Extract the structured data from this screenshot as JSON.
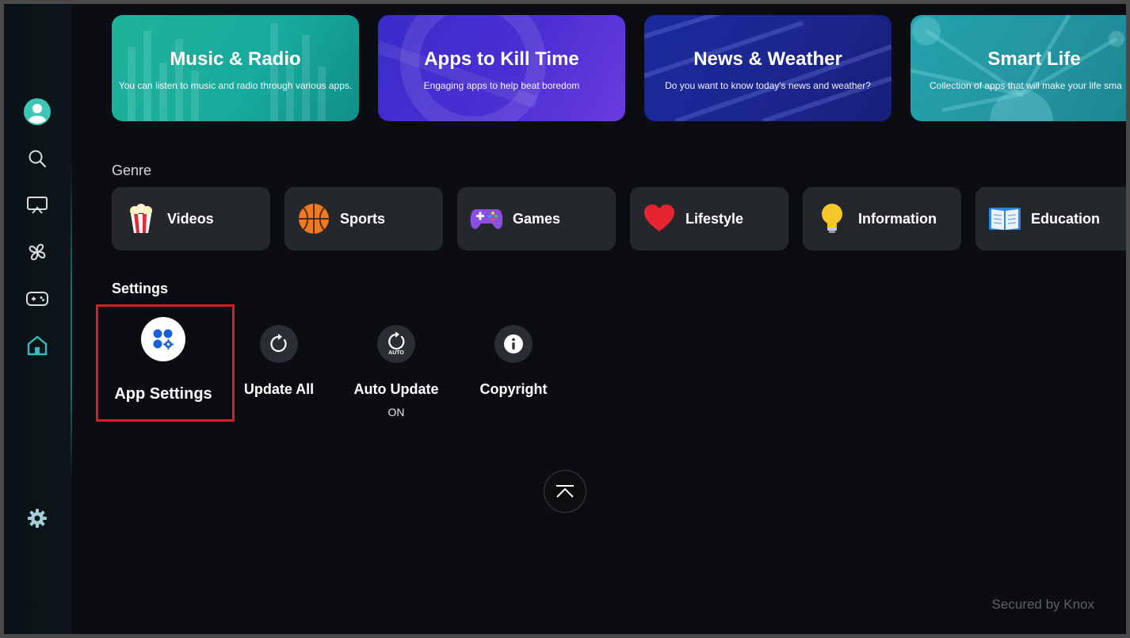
{
  "banners": [
    {
      "title": "Music & Radio",
      "subtitle": "You can listen to music and radio through various apps."
    },
    {
      "title": "Apps to Kill Time",
      "subtitle": "Engaging apps to help beat boredom"
    },
    {
      "title": "News & Weather",
      "subtitle": "Do you want to know today's news and weather?"
    },
    {
      "title": "Smart Life",
      "subtitle": "Collection of apps that will make your life sma"
    }
  ],
  "genre": {
    "title": "Genre",
    "items": [
      {
        "label": "Videos",
        "icon": "popcorn-icon"
      },
      {
        "label": "Sports",
        "icon": "basketball-icon"
      },
      {
        "label": "Games",
        "icon": "gamepad-icon"
      },
      {
        "label": "Lifestyle",
        "icon": "heart-icon"
      },
      {
        "label": "Information",
        "icon": "lightbulb-icon"
      },
      {
        "label": "Education",
        "icon": "book-icon"
      }
    ]
  },
  "settings": {
    "title": "Settings",
    "items": [
      {
        "label": "App Settings",
        "icon": "app-settings-icon"
      },
      {
        "label": "Update All",
        "icon": "refresh-icon"
      },
      {
        "label": "Auto Update",
        "status": "ON",
        "icon": "auto-update-icon",
        "icon_text": "AUTO"
      },
      {
        "label": "Copyright",
        "icon": "info-icon"
      }
    ]
  },
  "sidebar": {
    "items": [
      "profile-icon",
      "search-icon",
      "ambient-icon",
      "apps-icon",
      "game-icon",
      "home-icon"
    ],
    "bottom": "settings-gear-icon"
  },
  "footer": {
    "knox": "Secured by Knox"
  },
  "colors": {
    "accent": "#3ab8c4",
    "focus": "#d81d25"
  }
}
